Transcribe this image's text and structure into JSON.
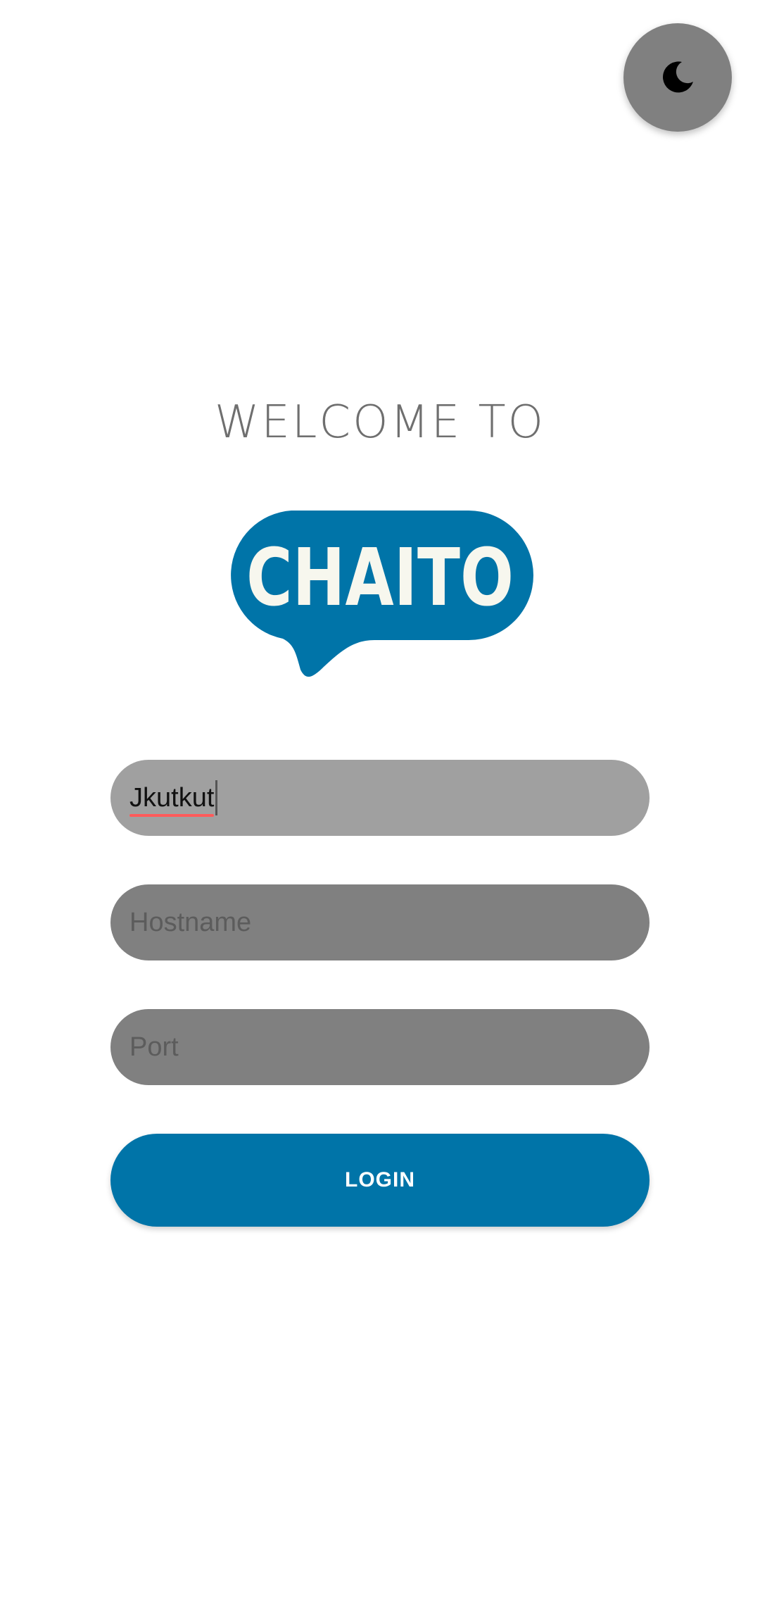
{
  "theme_toggle": {
    "icon": "moon-icon"
  },
  "header": {
    "welcome_text": "WELCOME TO"
  },
  "logo": {
    "text": "CHAITO",
    "bubble_color": "#0074a8",
    "text_color": "#f7f7ee"
  },
  "form": {
    "username": {
      "value": "Jkutkut"
    },
    "hostname": {
      "placeholder": "Hostname"
    },
    "port": {
      "placeholder": "Port"
    },
    "login_label": "LOGIN"
  },
  "colors": {
    "accent": "#0074a8",
    "field_active": "#a0a0a0",
    "field_inactive": "#808080"
  }
}
